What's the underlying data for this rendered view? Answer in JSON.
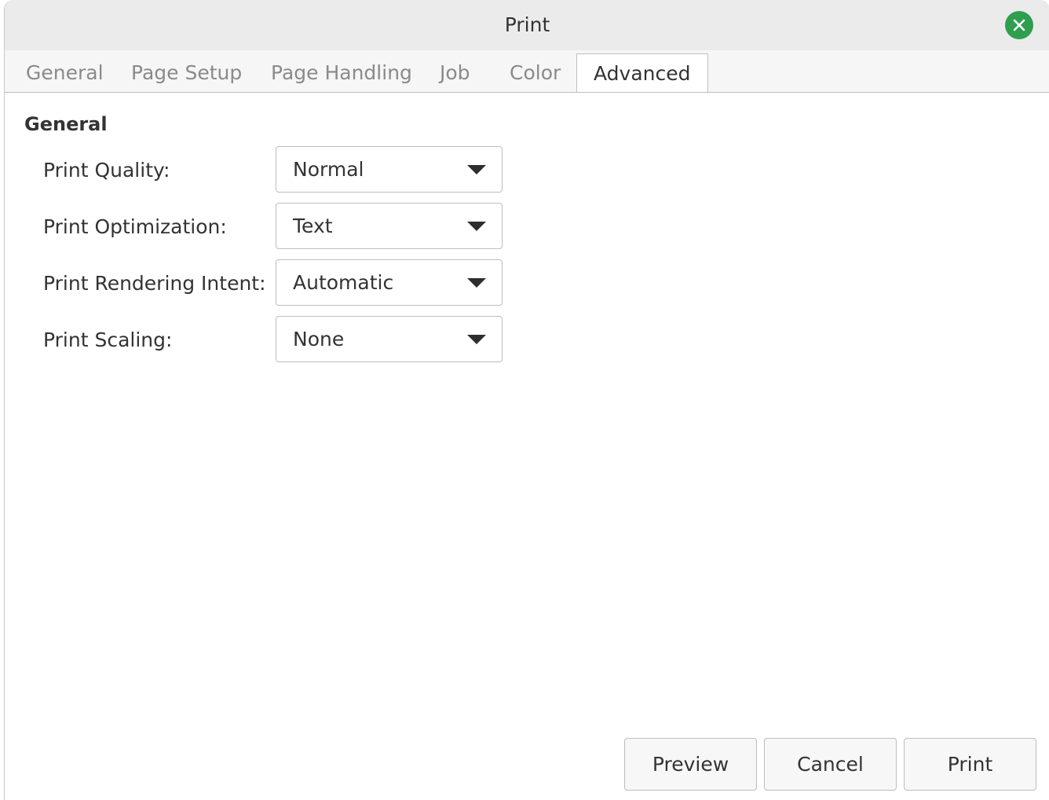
{
  "window": {
    "title": "Print"
  },
  "tabs": [
    {
      "label": "General",
      "active": false
    },
    {
      "label": "Page Setup",
      "active": false
    },
    {
      "label": "Page Handling",
      "active": false
    },
    {
      "label": "Job",
      "active": false
    },
    {
      "label": "Color",
      "active": false
    },
    {
      "label": "Advanced",
      "active": true
    }
  ],
  "advanced": {
    "section_title": "General",
    "settings": [
      {
        "label": "Print Quality:",
        "value": "Normal"
      },
      {
        "label": "Print Optimization:",
        "value": "Text"
      },
      {
        "label": "Print Rendering Intent:",
        "value": "Automatic"
      },
      {
        "label": "Print Scaling:",
        "value": "None"
      }
    ]
  },
  "buttons": {
    "preview": "Preview",
    "cancel": "Cancel",
    "print": "Print"
  },
  "colors": {
    "close_button": "#2f9e4f",
    "titlebar": "#ebebeb",
    "text": "#333333",
    "inactive_tab_text": "#8a8a8a"
  }
}
